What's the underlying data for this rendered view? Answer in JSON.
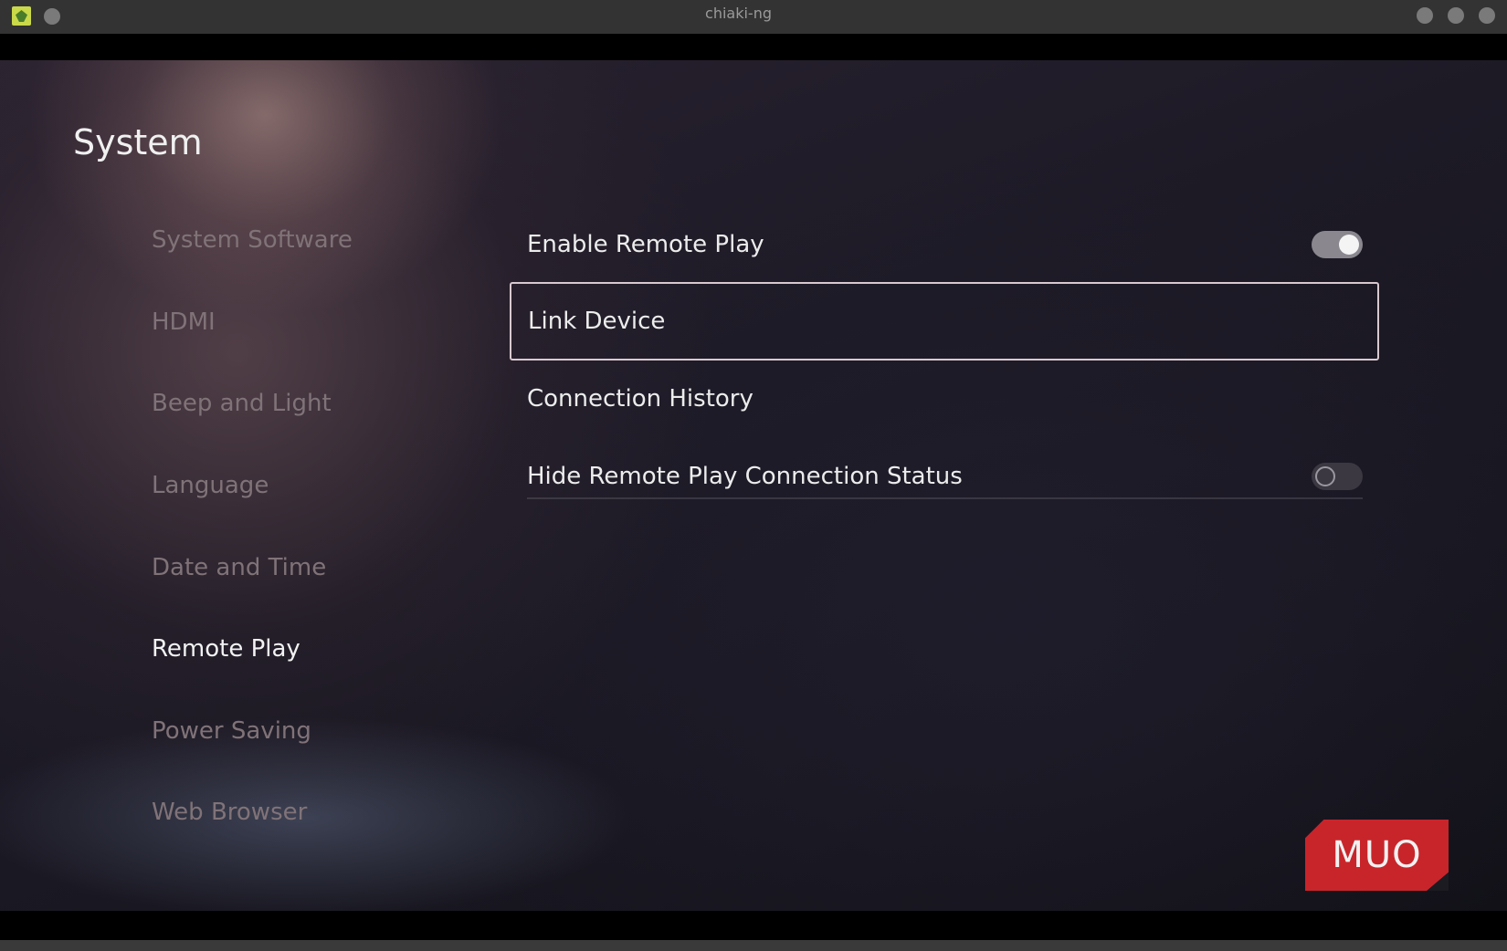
{
  "window": {
    "title": "chiaki-ng"
  },
  "page": {
    "title": "System"
  },
  "sidebar": {
    "items": [
      {
        "label": "System Software",
        "active": false
      },
      {
        "label": "HDMI",
        "active": false
      },
      {
        "label": "Beep and Light",
        "active": false
      },
      {
        "label": "Language",
        "active": false
      },
      {
        "label": "Date and Time",
        "active": false
      },
      {
        "label": "Remote Play",
        "active": true
      },
      {
        "label": "Power Saving",
        "active": false
      },
      {
        "label": "Web Browser",
        "active": false
      }
    ]
  },
  "settings": {
    "items": [
      {
        "label": "Enable Remote Play",
        "toggle": true,
        "state": "on"
      },
      {
        "label": "Link Device",
        "focused": true
      },
      {
        "label": "Connection History"
      },
      {
        "label": "Hide Remote Play Connection Status",
        "toggle": true,
        "state": "off"
      }
    ]
  },
  "watermark": {
    "text": "MUO",
    "color": "#c8252b"
  },
  "colors": {
    "text_primary": "#f0f0f0",
    "text_inactive": "#807378",
    "focus_border": "#d9c9cf"
  }
}
